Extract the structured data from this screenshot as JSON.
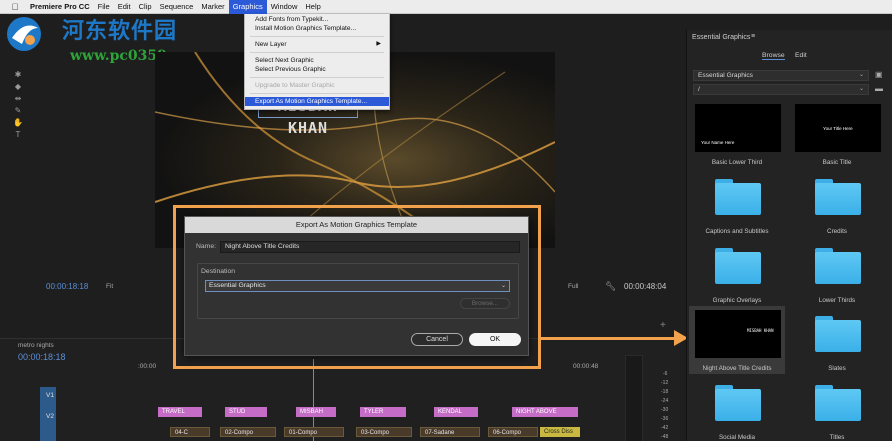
{
  "menubar": {
    "app": "Premiere Pro CC",
    "items": [
      "File",
      "Edit",
      "Clip",
      "Sequence",
      "Marker",
      "Graphics",
      "Window",
      "Help"
    ]
  },
  "graphics_menu": {
    "items": [
      {
        "label": "Add Fonts from Typekit..."
      },
      {
        "label": "Install Motion Graphics Template..."
      },
      {
        "label": "New Layer",
        "submenu": true
      },
      {
        "label": "Select Next Graphic"
      },
      {
        "label": "Select Previous Graphic"
      },
      {
        "label": "Upgrade to Master Graphic",
        "disabled": true
      },
      {
        "label": "Export As Motion Graphics Template...",
        "highlighted": true
      }
    ]
  },
  "watermark": {
    "title": "河东软件园",
    "url": "www.pc0359.cn"
  },
  "program_monitor": {
    "title_text": "MISBAH KHAN",
    "timecode": "00:00:18:18",
    "fit": "Fit",
    "quality": "Full",
    "duration": "00:00:48:04"
  },
  "export_dialog": {
    "title": "Export As Motion Graphics Template",
    "name_label": "Name:",
    "name_value": "Night Above Title Credits",
    "destination_label": "Destination",
    "destination_value": "Essential Graphics",
    "browse": "Browse...",
    "cancel": "Cancel",
    "ok": "OK"
  },
  "timeline": {
    "sequence": "metro nights",
    "timecode": "00:00:18:18",
    "ruler_start": ":00:00",
    "ruler_end": "00:00:48",
    "tracks": [
      "V1",
      "V2"
    ],
    "clips_top": [
      "TRAVEL",
      "STUD",
      "MISBAH",
      "TYLER",
      "KENDAL",
      "NIGHT ABOVE"
    ],
    "clips_bottom": [
      "04-C",
      "02-Compo",
      "01-Compo",
      "03-Compo",
      "07-Sadane",
      "06-Compo",
      "Cross Diss"
    ],
    "meter_ticks": [
      "-6",
      "-12",
      "-18",
      "-24",
      "-30",
      "-36",
      "-42",
      "-48",
      "-54"
    ]
  },
  "essential_graphics": {
    "panel_title": "Essential Graphics",
    "tabs": [
      "Browse",
      "Edit"
    ],
    "source": "Essential Graphics",
    "path": "/",
    "tiles": [
      {
        "label": "Basic Lower Third",
        "kind": "thumb",
        "thumb_text": "Your Name Here"
      },
      {
        "label": "Basic Title",
        "kind": "thumb",
        "thumb_text": "Your Title Here"
      },
      {
        "label": "Captions and Subtitles",
        "kind": "folder"
      },
      {
        "label": "Credits",
        "kind": "folder"
      },
      {
        "label": "Graphic Overlays",
        "kind": "folder"
      },
      {
        "label": "Lower Thirds",
        "kind": "folder"
      },
      {
        "label": "Night Above Title Credits",
        "kind": "thumb",
        "thumb_text": "MISBAH KHAN",
        "selected": true
      },
      {
        "label": "Slates",
        "kind": "folder"
      },
      {
        "label": "Social Media",
        "kind": "folder"
      },
      {
        "label": "Titles",
        "kind": "folder"
      }
    ]
  },
  "colors": {
    "accent": "#2b59d8",
    "highlight_frame": "#f2a24c",
    "timecode": "#5b8fd8",
    "folder": "#3ab0e8"
  }
}
